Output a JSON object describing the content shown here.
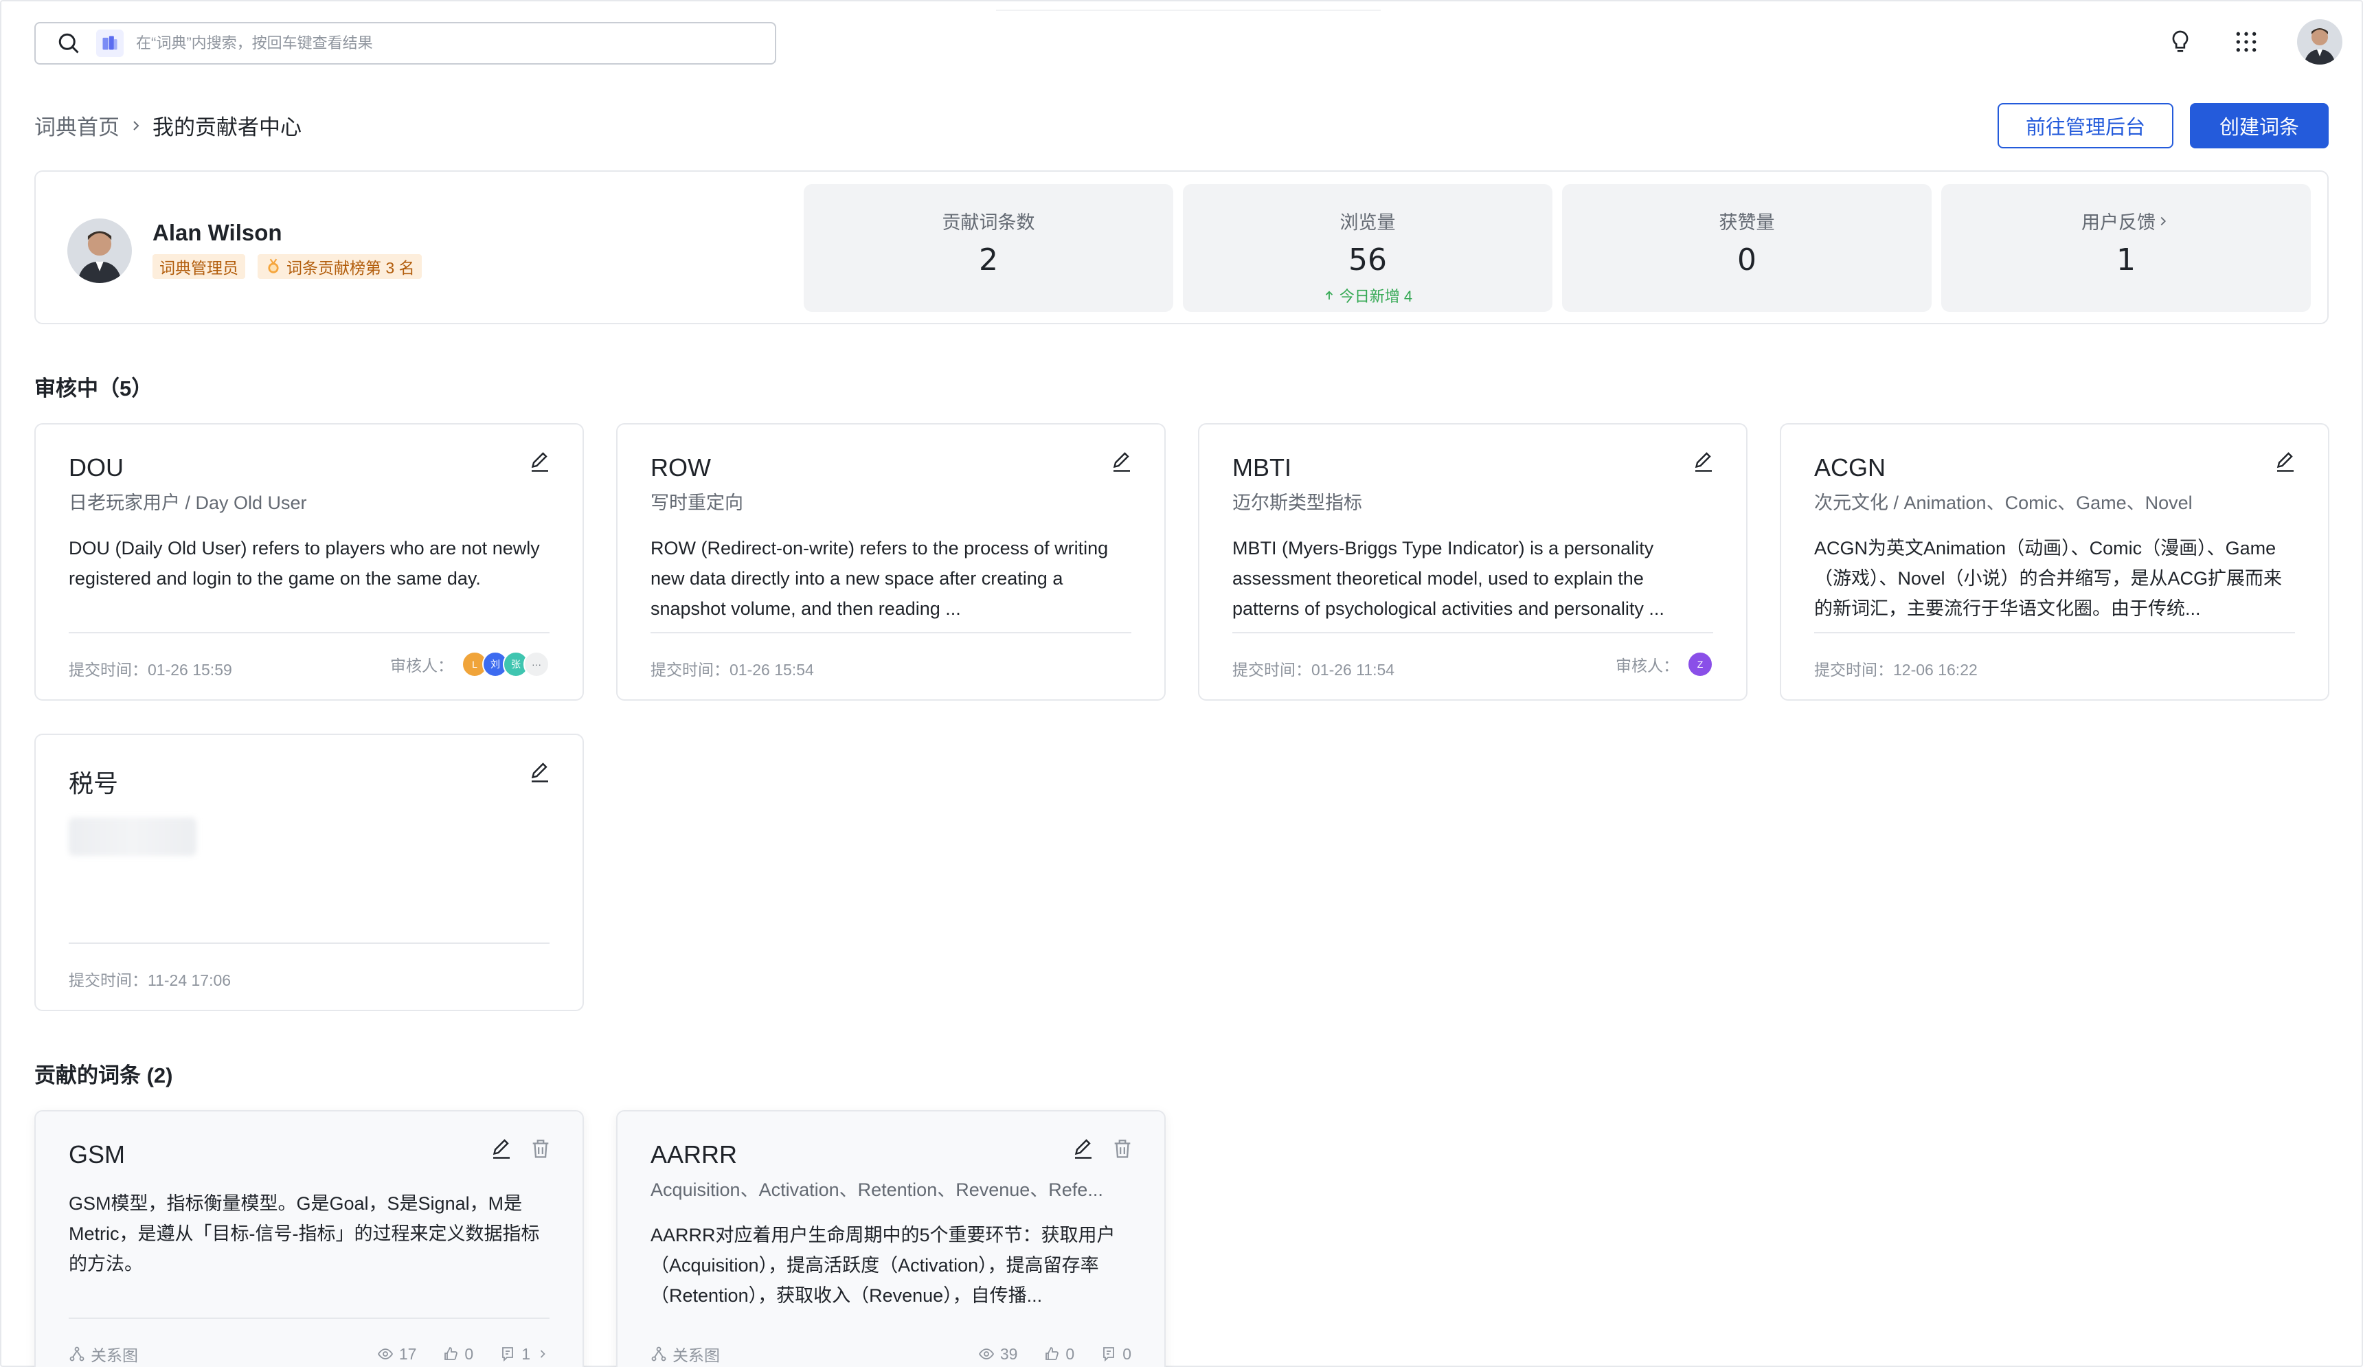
{
  "search": {
    "placeholder": "在“词典”内搜索，按回车键查看结果"
  },
  "breadcrumb": {
    "home": "词典首页",
    "current": "我的贡献者中心"
  },
  "actions": {
    "admin_label": "前往管理后台",
    "create_label": "创建词条"
  },
  "profile": {
    "name": "Alan Wilson",
    "badge_role": "词典管理员",
    "badge_rank": "词条贡献榜第 3 名"
  },
  "stats": [
    {
      "label": "贡献词条数",
      "value": "2",
      "sub": ""
    },
    {
      "label": "浏览量",
      "value": "56",
      "sub": "今日新增 4"
    },
    {
      "label": "获赞量",
      "value": "0",
      "sub": ""
    },
    {
      "label": "用户反馈",
      "value": "1",
      "sub": ""
    }
  ],
  "reviewing": {
    "title": "审核中（5）",
    "cards": [
      {
        "title": "DOU",
        "sub": "日老玩家用户 / Day Old User",
        "desc": "DOU (Daily Old User) refers to players who are not newly registered and login to the game on the same day.",
        "time": "提交时间：01-26 15:59",
        "reviewer_label": "审核人：",
        "reviewer_avatars": [
          "L",
          "刘",
          "张",
          "···"
        ]
      },
      {
        "title": "ROW",
        "sub": "写时重定向",
        "desc": "ROW (Redirect-on-write) refers to the process of writing new data directly into a new space after creating a snapshot volume, and then reading ...",
        "time": "提交时间：01-26 15:54"
      },
      {
        "title": "MBTI",
        "sub": "迈尔斯类型指标",
        "desc": "MBTI (Myers-Briggs Type Indicator) is a personality assessment theoretical model, used to explain the patterns of psychological activities and personality ...",
        "time": "提交时间：01-26 11:54",
        "reviewer_label": "审核人：",
        "reviewer_avatars": [
          "Z"
        ]
      },
      {
        "title": "ACGN",
        "sub": "次元文化 / Animation、Comic、Game、Novel",
        "desc": "ACGN为英文Animation（动画）、Comic（漫画）、Game（游戏）、Novel（小说）的合并缩写，是从ACG扩展而来的新词汇，主要流行于华语文化圈。由于传统...",
        "time": "提交时间：12-06 16:22"
      },
      {
        "title": "税号",
        "sub": "",
        "desc": "",
        "time": "提交时间：11-24 17:06"
      }
    ]
  },
  "contributed": {
    "title": "贡献的词条 (2)",
    "cards": [
      {
        "title": "GSM",
        "sub": "",
        "desc": "GSM模型，指标衡量模型。G是Goal，S是Signal，M是Metric，是遵从「目标-信号-指标」的过程来定义数据指标的方法。",
        "relation": "关系图",
        "views": "17",
        "likes": "0",
        "comments": "1"
      },
      {
        "title": "AARRR",
        "sub": "Acquisition、Activation、Retention、Revenue、Refe...",
        "desc": "AARRR对应着用户生命周期中的5个重要环节：获取用户（Acquisition），提高活跃度（Activation），提高留存率（Retention），获取收入（Revenue），自传播...",
        "relation": "关系图",
        "views": "39",
        "likes": "0",
        "comments": "0"
      }
    ]
  },
  "colors": {
    "primary": "#245bdb",
    "badge_bg": "#fdeedc",
    "badge_text": "#b25d0c",
    "positive": "#34a853"
  }
}
